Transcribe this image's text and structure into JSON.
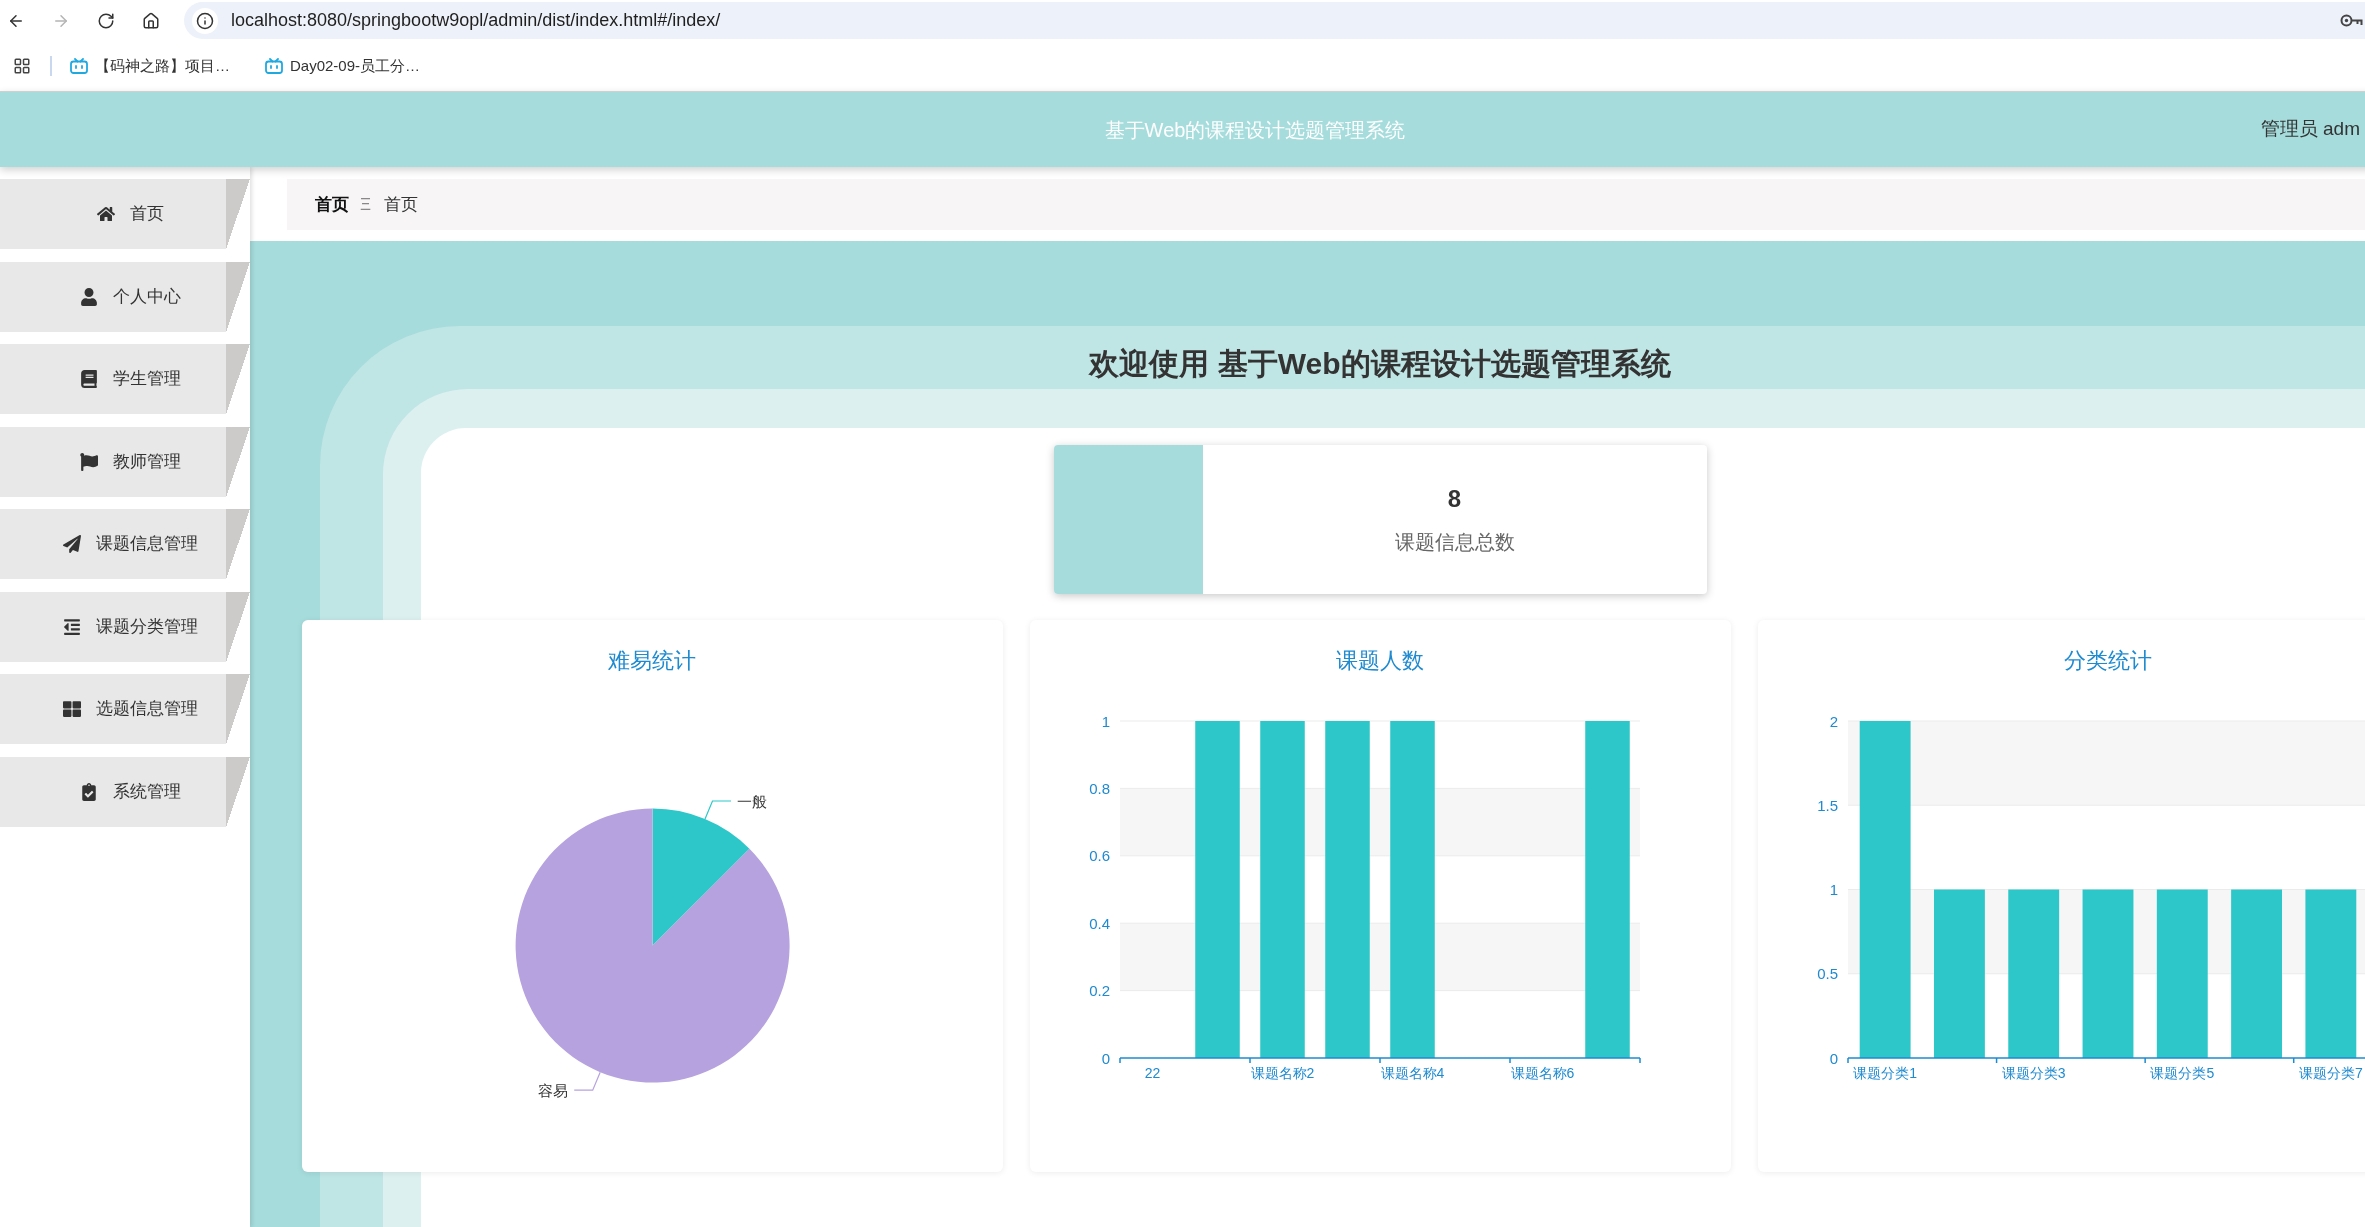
{
  "browser": {
    "back_disabled": false,
    "forward_disabled": true,
    "url": "localhost:8080/springbootw9opl/admin/dist/index.html#/index/",
    "bookmarks": [
      {
        "label": "【码神之路】项目…"
      },
      {
        "label": "Day02-09-员工分…"
      }
    ]
  },
  "header": {
    "title": "基于Web的课程设计选题管理系统",
    "user": "管理员 adm"
  },
  "sidebar": {
    "items": [
      {
        "label": "首页"
      },
      {
        "label": "个人中心"
      },
      {
        "label": "学生管理"
      },
      {
        "label": "教师管理"
      },
      {
        "label": "课题信息管理"
      },
      {
        "label": "课题分类管理"
      },
      {
        "label": "选题信息管理"
      },
      {
        "label": "系统管理"
      }
    ]
  },
  "breadcrumb": {
    "items": [
      "首页",
      "首页"
    ],
    "separator": "Ξ"
  },
  "welcome": {
    "title": "欢迎使用 基于Web的课程设计选题管理系统"
  },
  "stats": [
    {
      "value": "8",
      "label": "课题信息总数"
    }
  ],
  "charts": [
    {
      "chart_data": {
        "type": "pie",
        "title": "难易统计",
        "categories": [
          "一般",
          "容易"
        ],
        "values": [
          12.5,
          87.5
        ],
        "colors": [
          "#2ec7c9",
          "#b6a2de"
        ]
      }
    },
    {
      "chart_data": {
        "type": "bar",
        "title": "课题人数",
        "categories": [
          "22",
          null,
          "课题名称2",
          null,
          "课题名称4",
          null,
          "课题名称6",
          null
        ],
        "series": [
          {
            "color": "#2ec7c9",
            "values": [
              0,
              1,
              1,
              1,
              1,
              0,
              0,
              1
            ]
          }
        ],
        "ylim": [
          0,
          1
        ],
        "yticks": [
          0,
          0.2,
          0.4,
          0.6,
          0.8,
          1
        ],
        "grid": true
      }
    },
    {
      "chart_data": {
        "type": "bar",
        "title": "分类统计",
        "categories": [
          "课题分类1",
          null,
          "课题分类3",
          null,
          "课题分类5",
          null,
          "课题分类7"
        ],
        "series": [
          {
            "color": "#2ec7c9",
            "values": [
              2,
              1,
              1,
              1,
              1,
              1,
              1
            ]
          }
        ],
        "ylim": [
          0,
          2
        ],
        "yticks": [
          0,
          0.5,
          1,
          1.5,
          2
        ],
        "grid": true
      }
    }
  ]
}
